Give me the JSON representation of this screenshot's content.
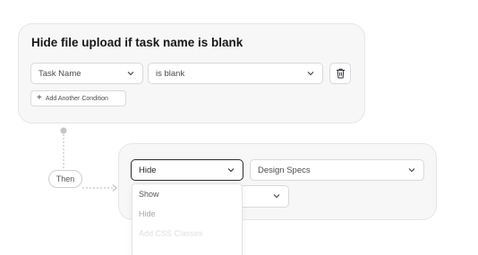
{
  "rule": {
    "title": "Hide file upload if task name is blank"
  },
  "condition": {
    "field_value": "Task Name",
    "operator_value": "is blank",
    "delete_icon": "trash-icon",
    "add_condition_label": "Add Another Condition"
  },
  "connector": {
    "then_label": "Then"
  },
  "action": {
    "action_value": "Hide",
    "target_value": "Design Specs",
    "dropdown_options": [
      {
        "label": "Show"
      },
      {
        "label": "Hide"
      },
      {
        "label": "Add CSS Classes"
      },
      {
        "label": ""
      }
    ]
  },
  "colors": {
    "card_bg": "#f7f7f8",
    "card_border": "#e6e6e9",
    "focus_border": "#2b2b30"
  }
}
